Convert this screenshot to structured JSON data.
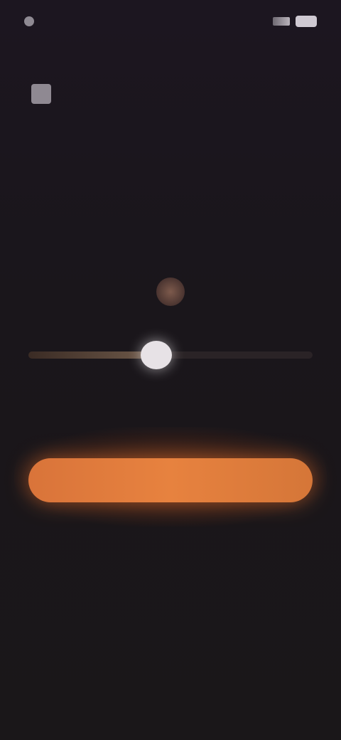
{
  "status_bar": {
    "time": "",
    "battery_icon": "battery-icon",
    "signal_icon": "signal-icon"
  },
  "header": {
    "title": "",
    "description": "",
    "hint": ""
  },
  "slider": {
    "value_fraction": 0.45,
    "min_label": "",
    "max_label": ""
  },
  "cta": {
    "label": ""
  },
  "colors": {
    "accent": "#e07a3b",
    "background": "#1b161c"
  }
}
